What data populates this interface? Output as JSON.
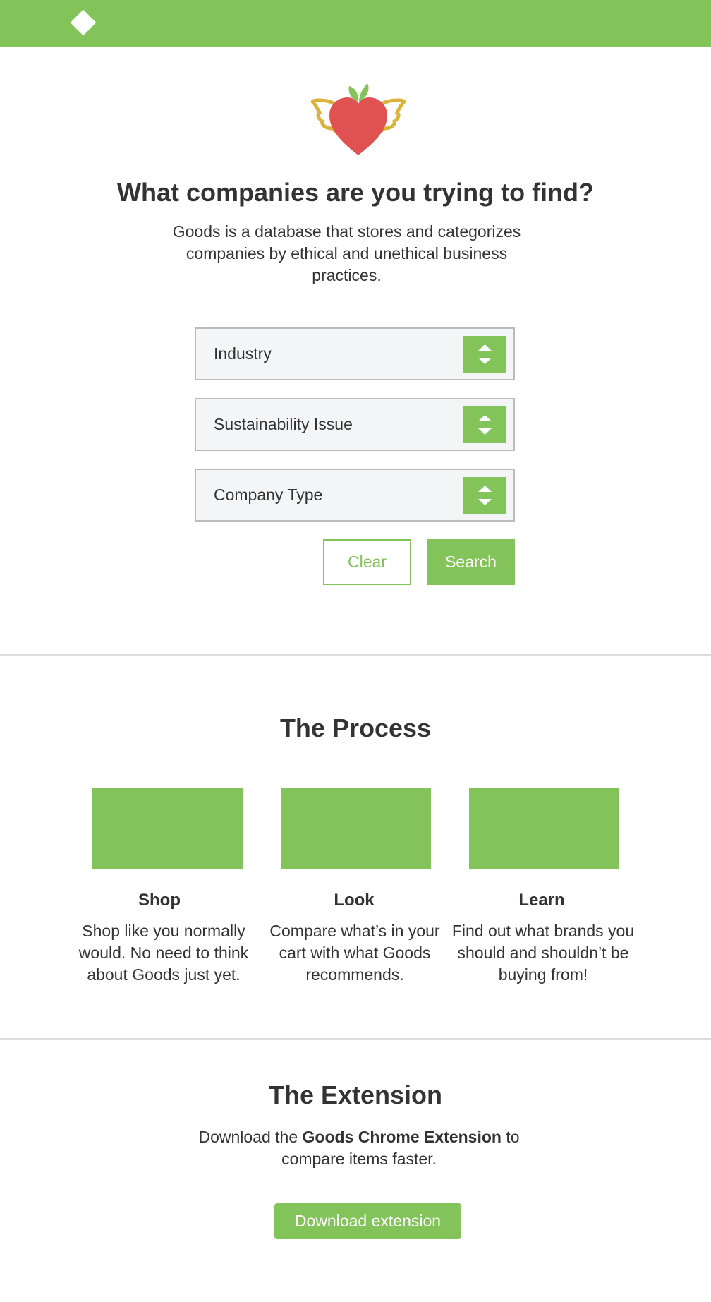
{
  "brand": {
    "logo_icon": "diamond-logo-icon",
    "hero_icon": "winged-apple-heart-icon",
    "accent_color": "#82c45a"
  },
  "hero": {
    "headline": "What companies are you trying to find?",
    "description": "Goods is a database that stores and categorizes companies by ethical and unethical business practices."
  },
  "filters": [
    {
      "label": "Industry"
    },
    {
      "label": "Sustainability Issue"
    },
    {
      "label": "Company Type"
    }
  ],
  "actions": {
    "clear_label": "Clear",
    "search_label": "Search"
  },
  "process": {
    "title": "The Process",
    "steps": [
      {
        "title": "Shop",
        "description": "Shop like you normally would. No need to think about Goods just yet."
      },
      {
        "title": "Look",
        "description": "Compare what’s in your cart with what Goods recommends."
      },
      {
        "title": "Learn",
        "description": "Find out what brands you should and shouldn’t be buying from!"
      }
    ]
  },
  "extension": {
    "title": "The Extension",
    "description_before": "Download the ",
    "description_bold": "Goods Chrome Extension",
    "description_after": " to compare items faster.",
    "button_label": "Download extension"
  }
}
